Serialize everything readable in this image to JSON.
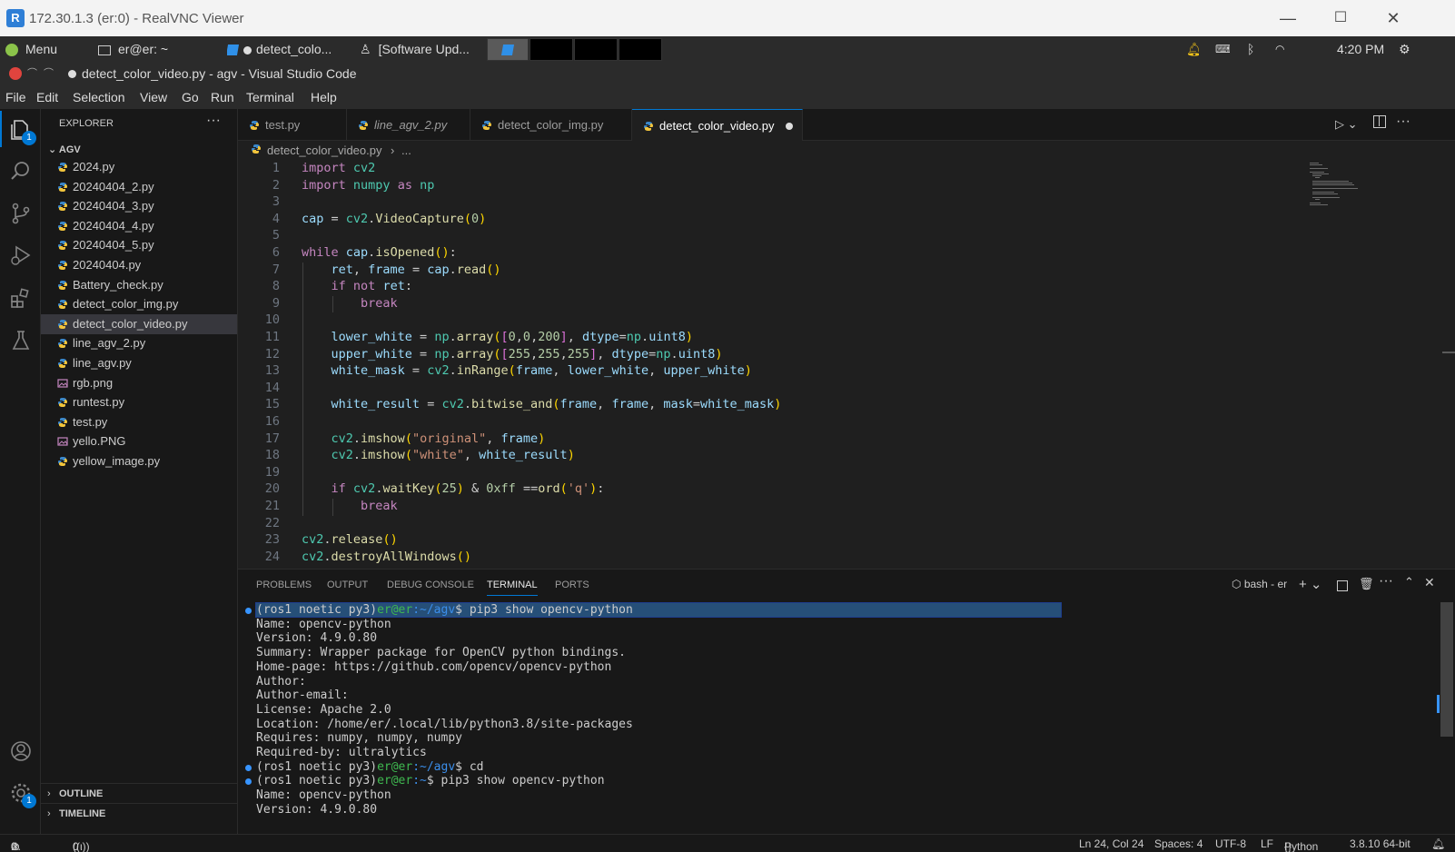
{
  "vnc": {
    "title": "172.30.1.3 (er:0) - RealVNC Viewer",
    "logo": "R",
    "minimize": "—",
    "maximize": "☐",
    "close": "✕"
  },
  "taskbar": {
    "menu": "Menu",
    "terminal_task": "er@er: ~",
    "vscode_task": "detect_colo...",
    "update_task": "[Software Upd...",
    "clock": "4:20 PM"
  },
  "vscode": {
    "window_title": "detect_color_video.py - agv - Visual Studio Code",
    "menu": [
      "File",
      "Edit",
      "Selection",
      "View",
      "Go",
      "Run",
      "Terminal",
      "Help"
    ],
    "explorer": {
      "header": "EXPLORER",
      "more": "···",
      "folder": "AGV",
      "files": [
        {
          "name": "2024.py",
          "type": "py",
          "selected": false
        },
        {
          "name": "20240404_2.py",
          "type": "py",
          "selected": false
        },
        {
          "name": "20240404_3.py",
          "type": "py",
          "selected": false
        },
        {
          "name": "20240404_4.py",
          "type": "py",
          "selected": false
        },
        {
          "name": "20240404_5.py",
          "type": "py",
          "selected": false
        },
        {
          "name": "20240404.py",
          "type": "py",
          "selected": false
        },
        {
          "name": "Battery_check.py",
          "type": "py",
          "selected": false
        },
        {
          "name": "detect_color_img.py",
          "type": "py",
          "selected": false
        },
        {
          "name": "detect_color_video.py",
          "type": "py",
          "selected": true
        },
        {
          "name": "line_agv_2.py",
          "type": "py",
          "selected": false
        },
        {
          "name": "line_agv.py",
          "type": "py",
          "selected": false
        },
        {
          "name": "rgb.png",
          "type": "img",
          "selected": false
        },
        {
          "name": "runtest.py",
          "type": "py",
          "selected": false
        },
        {
          "name": "test.py",
          "type": "py",
          "selected": false
        },
        {
          "name": "yello.PNG",
          "type": "img",
          "selected": false
        },
        {
          "name": "yellow_image.py",
          "type": "py",
          "selected": false
        }
      ],
      "outline": "OUTLINE",
      "timeline": "TIMELINE"
    },
    "tabs": [
      {
        "label": "test.py",
        "italic": false,
        "active": false
      },
      {
        "label": "line_agv_2.py",
        "italic": true,
        "active": false
      },
      {
        "label": "detect_color_img.py",
        "italic": false,
        "active": false
      },
      {
        "label": "detect_color_video.py",
        "italic": false,
        "active": true
      }
    ],
    "breadcrumb": {
      "file": "detect_color_video.py",
      "sep": "›",
      "rest": "..."
    },
    "code_lines": [
      "import cv2",
      "import numpy as np",
      "",
      "cap = cv2.VideoCapture(0)",
      "",
      "while cap.isOpened():",
      "    ret, frame = cap.read()",
      "    if not ret:",
      "        break",
      "",
      "    lower_white = np.array([0,0,200], dtype=np.uint8)",
      "    upper_white = np.array([255,255,255], dtype=np.uint8)",
      "    white_mask = cv2.inRange(frame, lower_white, upper_white)",
      "",
      "    white_result = cv2.bitwise_and(frame, frame, mask=white_mask)",
      "",
      "    cv2.imshow(\"original\", frame)",
      "    cv2.imshow(\"white\", white_result)",
      "",
      "    if cv2.waitKey(25) & 0xff ==ord('q'):",
      "        break",
      "",
      "cv2.release()",
      "cv2.destroyAllWindows()"
    ],
    "panel": {
      "tabs": [
        "PROBLEMS",
        "OUTPUT",
        "DEBUG CONSOLE",
        "TERMINAL",
        "PORTS"
      ],
      "active_tab": "TERMINAL",
      "shell": "bash - er",
      "terminal": [
        {
          "prompt": "(ros1 noetic py3)",
          "user": "er@er",
          "path": ":~/agv",
          "cmd": "$ pip3 show opencv-python",
          "dot": true,
          "highlight": true
        },
        {
          "text": "Name: opencv-python"
        },
        {
          "text": "Version: 4.9.0.80"
        },
        {
          "text": "Summary: Wrapper package for OpenCV python bindings."
        },
        {
          "text": "Home-page: https://github.com/opencv/opencv-python"
        },
        {
          "text": "Author:"
        },
        {
          "text": "Author-email:"
        },
        {
          "text": "License: Apache 2.0"
        },
        {
          "text": "Location: /home/er/.local/lib/python3.8/site-packages"
        },
        {
          "text": "Requires: numpy, numpy, numpy"
        },
        {
          "text": "Required-by: ultralytics"
        },
        {
          "prompt": "(ros1 noetic py3)",
          "user": "er@er",
          "path": ":~/agv",
          "cmd": "$ cd",
          "dot": true
        },
        {
          "prompt": "(ros1 noetic py3)",
          "user": "er@er",
          "path": ":~",
          "cmd": "$ pip3 show opencv-python",
          "dot": true
        },
        {
          "text": "Name: opencv-python"
        },
        {
          "text": "Version: 4.9.0.80"
        }
      ]
    },
    "status": {
      "errors": "0",
      "warnings": "0",
      "ports": "0",
      "position": "Ln 24, Col 24",
      "spaces": "Spaces: 4",
      "encoding": "UTF-8",
      "eol": "LF",
      "language": "Python",
      "interpreter": "3.8.10 64-bit"
    },
    "badges": {
      "explorer": "1",
      "settings": "1"
    }
  },
  "colors": {
    "accent": "#0078d4",
    "vnc_title_bg": "#f3f3f3",
    "editor_bg": "#1f1f1f",
    "sidebar_bg": "#181818"
  }
}
